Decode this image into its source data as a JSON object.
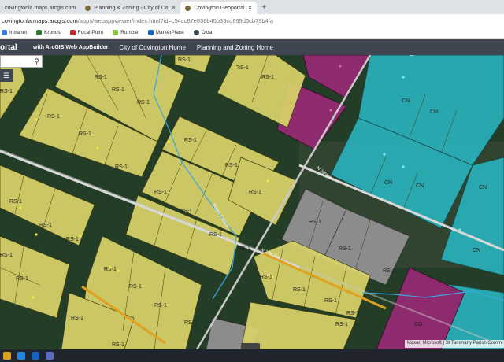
{
  "browser": {
    "tabs": [
      {
        "label": "covingtonla.maps.arcgis.com",
        "active": false
      },
      {
        "label": "Planning & Zoning - City of Co",
        "active": false
      },
      {
        "label": "Covington Geoportal",
        "active": true
      }
    ],
    "url_host": "covingtonla.maps.arcgis.com",
    "url_path": "/apps/webappviewer/index.html?id=c54cc87e836b45b39cd699d6cb79b4fa",
    "bookmarks": [
      "Intranet",
      "Kronos",
      "Focal Point",
      "Rumble",
      "MarketPlace",
      "Okta"
    ]
  },
  "app": {
    "title": "ortal",
    "subtitle": "with ArcGIS Web AppBuilder",
    "nav": [
      "City of Covington Home",
      "Planning and Zoning Home"
    ]
  },
  "map": {
    "zoning_label_residential": "RS-1",
    "zoning_label_commercial": "CN",
    "attribution": "Maxar, Microsoft | St Tammany Parish Comm",
    "colors": {
      "residential": "#d9d36a",
      "commercial": "#2ab3be",
      "institutional": "#8e2a6e",
      "gray": "#8c8c8c"
    }
  },
  "icons": [
    "search-icon",
    "layers-icon",
    "close-icon",
    "plus-icon"
  ]
}
